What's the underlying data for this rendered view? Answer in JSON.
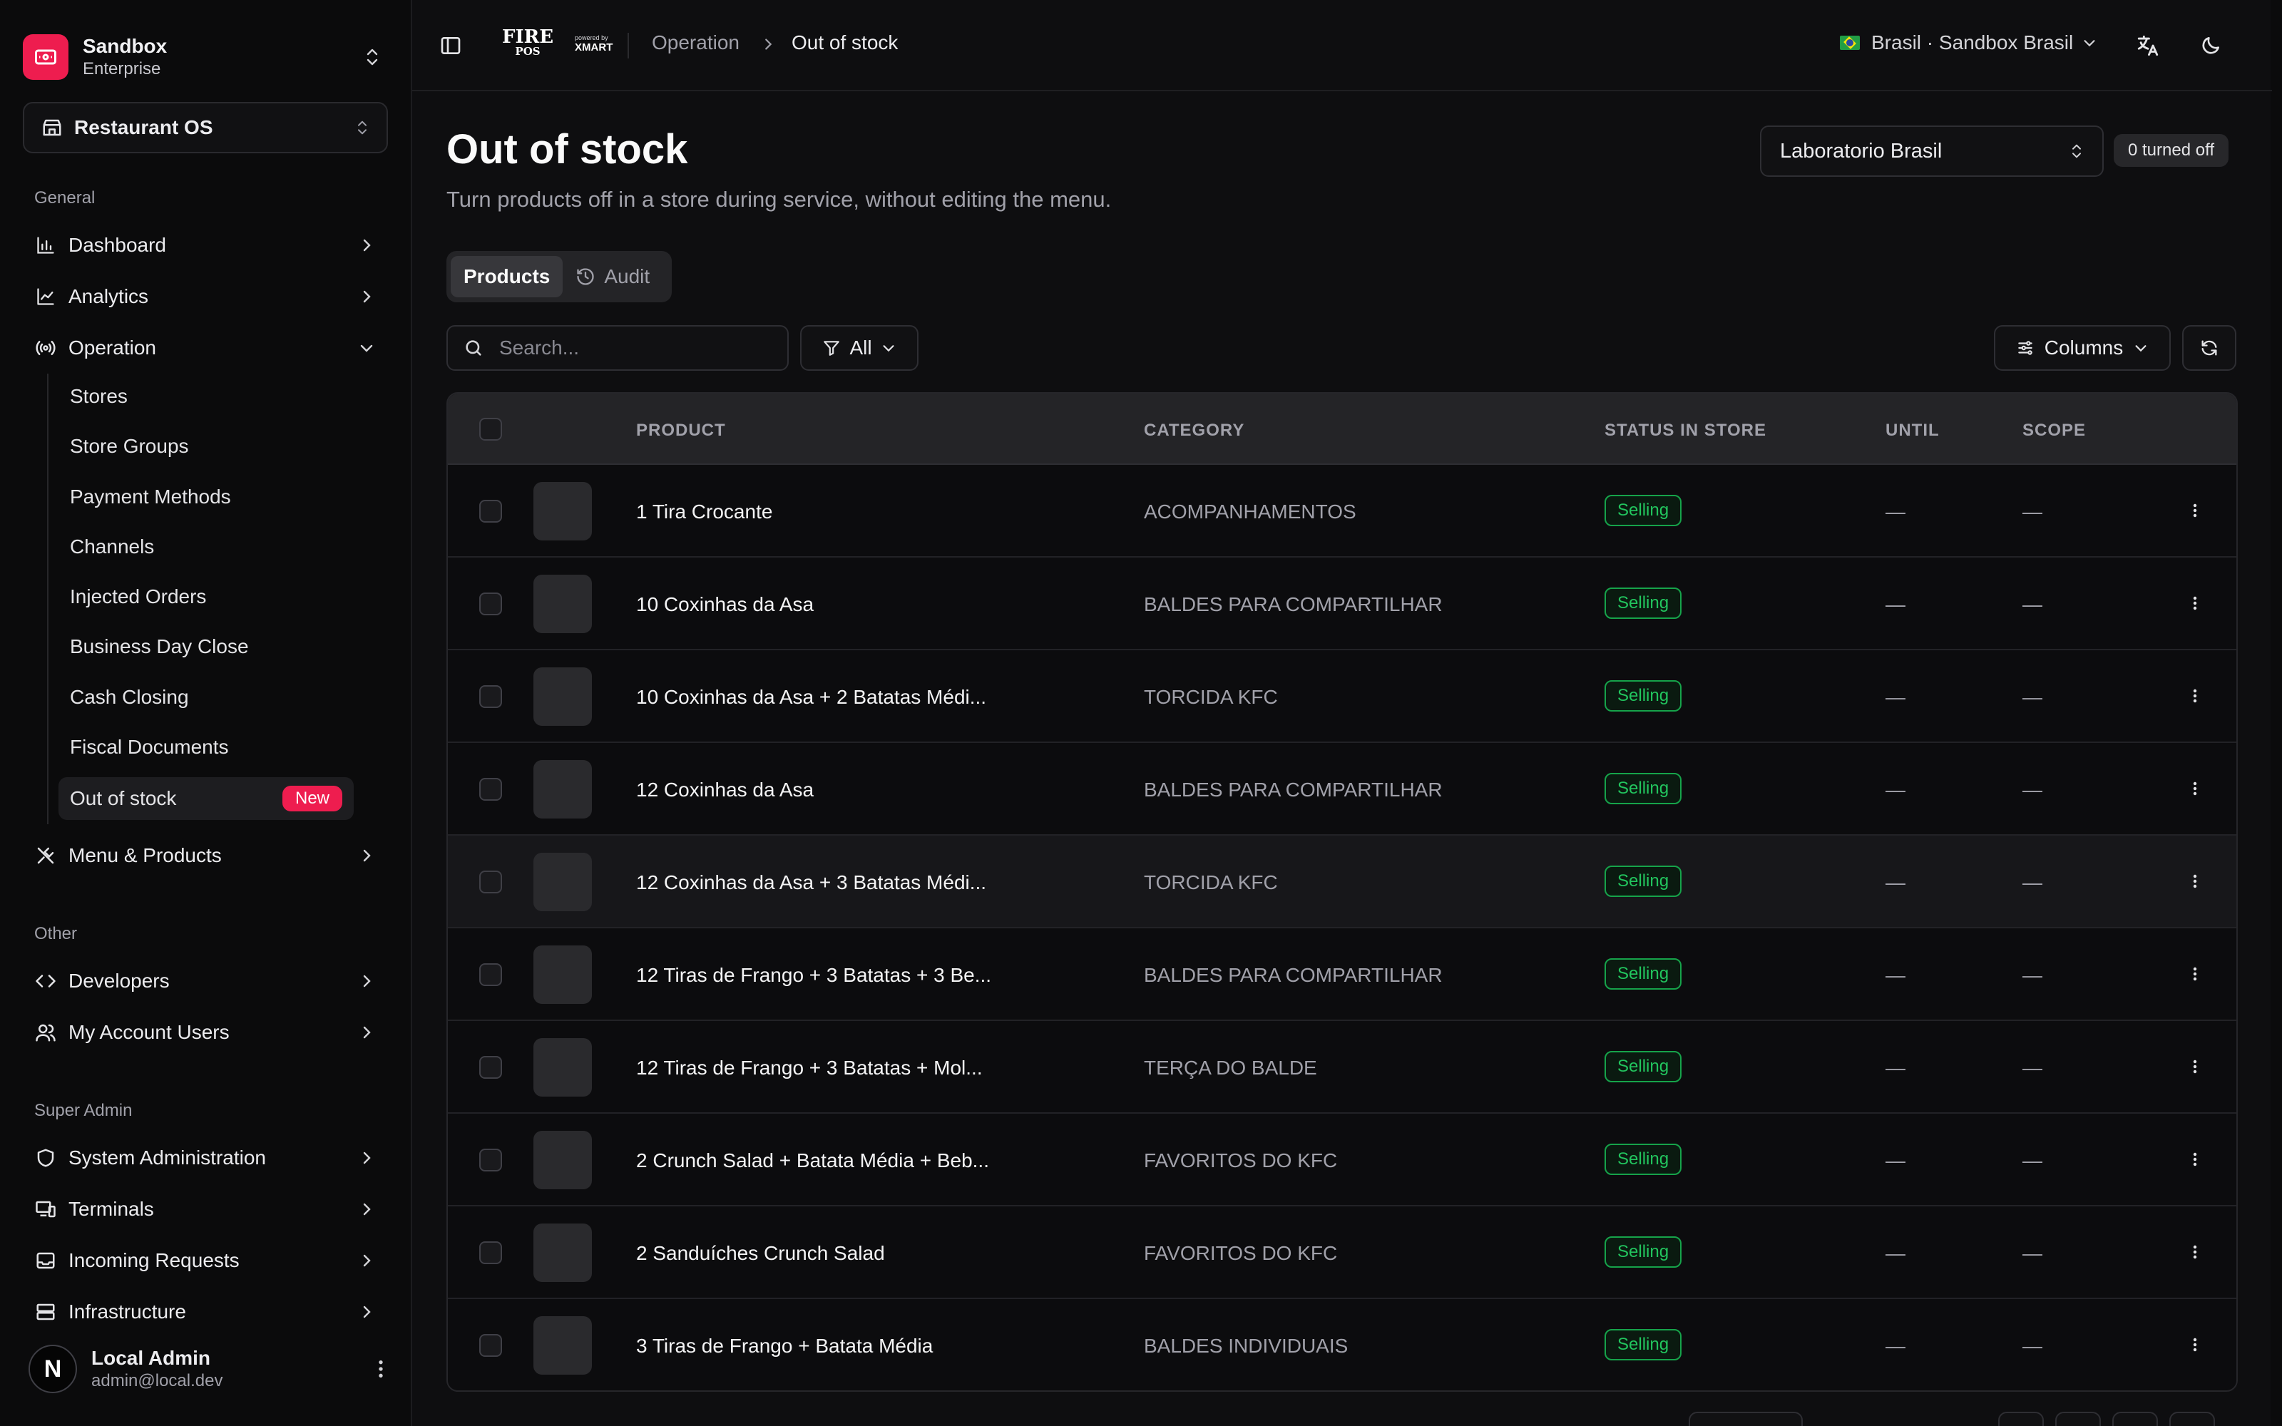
{
  "org": {
    "name": "Sandbox",
    "plan": "Enterprise"
  },
  "app_switcher": {
    "label": "Restaurant OS"
  },
  "sidebar": {
    "general_label": "General",
    "general": [
      {
        "label": "Dashboard"
      },
      {
        "label": "Analytics"
      },
      {
        "label": "Operation"
      }
    ],
    "operation_sub": [
      {
        "label": "Stores"
      },
      {
        "label": "Store Groups"
      },
      {
        "label": "Payment Methods"
      },
      {
        "label": "Channels"
      },
      {
        "label": "Injected Orders"
      },
      {
        "label": "Business Day Close"
      },
      {
        "label": "Cash Closing"
      },
      {
        "label": "Fiscal Documents"
      },
      {
        "label": "Out of stock",
        "badge": "New"
      }
    ],
    "menu_products": {
      "label": "Menu & Products"
    },
    "other_label": "Other",
    "other": [
      {
        "label": "Developers"
      },
      {
        "label": "My Account Users"
      }
    ],
    "super_admin_label": "Super Admin",
    "super_admin": [
      {
        "label": "System Administration"
      },
      {
        "label": "Terminals"
      },
      {
        "label": "Incoming Requests"
      },
      {
        "label": "Infrastructure"
      }
    ]
  },
  "user": {
    "initial": "N",
    "name": "Local Admin",
    "email": "admin@local.dev"
  },
  "topbar": {
    "brand_top": "FIRE",
    "brand_bottom": "POS",
    "brand_powered": "powered by",
    "brand_partner": "XMART",
    "breadcrumb": [
      "Operation",
      "Out of stock"
    ],
    "region": "Brasil · Sandbox Brasil"
  },
  "page": {
    "title": "Out of stock",
    "subtitle": "Turn products off in a store during service, without editing the menu.",
    "store": "Laboratorio Brasil",
    "turned_off": "0 turned off",
    "tabs": [
      "Products",
      "Audit"
    ],
    "search_placeholder": "Search...",
    "filter": "All",
    "columns": "Columns"
  },
  "table": {
    "headers": [
      "PRODUCT",
      "CATEGORY",
      "STATUS IN STORE",
      "UNTIL",
      "SCOPE"
    ],
    "rows": [
      {
        "product": "1 Tira Crocante",
        "category": "ACOMPANHAMENTOS",
        "status": "Selling",
        "until": "—",
        "scope": "—"
      },
      {
        "product": "10 Coxinhas da Asa",
        "category": "BALDES PARA COMPARTILHAR",
        "status": "Selling",
        "until": "—",
        "scope": "—"
      },
      {
        "product": "10 Coxinhas da Asa + 2 Batatas Médi...",
        "category": "TORCIDA KFC",
        "status": "Selling",
        "until": "—",
        "scope": "—"
      },
      {
        "product": "12 Coxinhas da Asa",
        "category": "BALDES PARA COMPARTILHAR",
        "status": "Selling",
        "until": "—",
        "scope": "—"
      },
      {
        "product": "12 Coxinhas da Asa + 3 Batatas Médi...",
        "category": "TORCIDA KFC",
        "status": "Selling",
        "until": "—",
        "scope": "—"
      },
      {
        "product": "12 Tiras de Frango + 3 Batatas + 3 Be...",
        "category": "BALDES PARA COMPARTILHAR",
        "status": "Selling",
        "until": "—",
        "scope": "—"
      },
      {
        "product": "12 Tiras de Frango + 3 Batatas + Mol...",
        "category": "TERÇA DO BALDE",
        "status": "Selling",
        "until": "—",
        "scope": "—"
      },
      {
        "product": "2 Crunch Salad + Batata Média + Beb...",
        "category": "FAVORITOS DO KFC",
        "status": "Selling",
        "until": "—",
        "scope": "—"
      },
      {
        "product": "2 Sanduíches Crunch Salad",
        "category": "FAVORITOS DO KFC",
        "status": "Selling",
        "until": "—",
        "scope": "—"
      },
      {
        "product": "3 Tiras de Frango + Batata Média",
        "category": "BALDES INDIVIDUAIS",
        "status": "Selling",
        "until": "—",
        "scope": "—"
      }
    ]
  },
  "colors": {
    "accent": "#ee1d4f",
    "selling": "#22c55e"
  }
}
